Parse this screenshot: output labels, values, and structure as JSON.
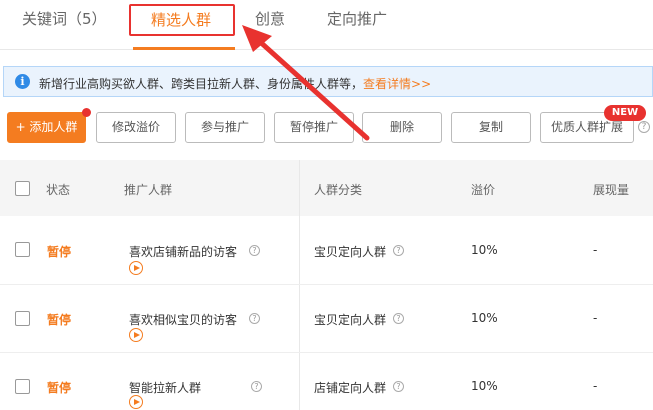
{
  "tabs": [
    {
      "label": "关键词（5）"
    },
    {
      "label": "精选人群"
    },
    {
      "label": "创意"
    },
    {
      "label": "定向推广"
    }
  ],
  "banner": {
    "text": "新增行业高购买欲人群、跨类目拉新人群、身份属性人群等，",
    "link": "查看详情>>"
  },
  "toolbar": {
    "add_label": "+ 添加人群",
    "modify_label": "修改溢价",
    "join_label": "参与推广",
    "pause_label": "暂停推广",
    "delete_label": "删除",
    "copy_label": "复制",
    "expand_label": "优质人群扩展",
    "new_badge": "NEW"
  },
  "table": {
    "headers": [
      "状态",
      "推广人群",
      "人群分类",
      "溢价",
      "展现量"
    ],
    "rows": [
      {
        "status": "暂停",
        "crowd": "喜欢店铺新品的访客",
        "category": "宝贝定向人群",
        "premium": "10%",
        "impressions": "-"
      },
      {
        "status": "暂停",
        "crowd": "喜欢相似宝贝的访客",
        "category": "宝贝定向人群",
        "premium": "10%",
        "impressions": "-"
      },
      {
        "status": "暂停",
        "crowd": "智能拉新人群",
        "category": "店铺定向人群",
        "premium": "10%",
        "impressions": "-"
      }
    ]
  },
  "colors": {
    "accent": "#f47c20",
    "highlight": "#e8322f",
    "info": "#2f8ae6"
  }
}
